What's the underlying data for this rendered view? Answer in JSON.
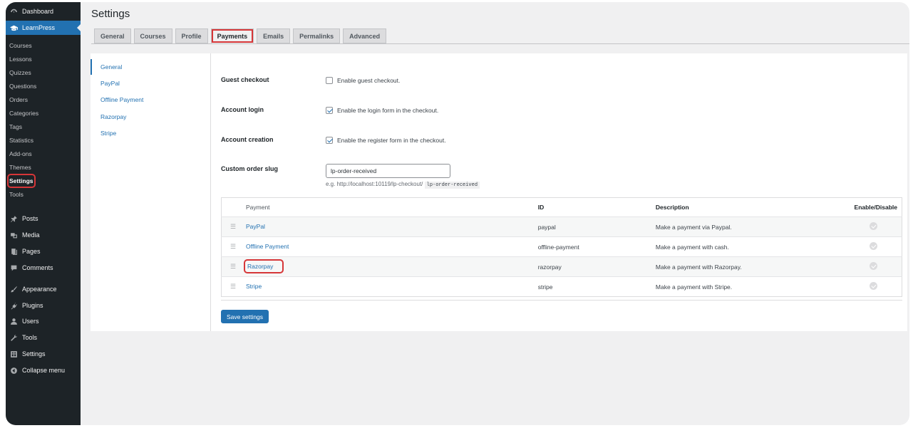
{
  "page_title": "Settings",
  "sidebar": {
    "top": [
      {
        "label": "Dashboard",
        "icon": "dashboard-icon"
      },
      {
        "label": "LearnPress",
        "icon": "graduation-cap-icon"
      }
    ],
    "learnpress_submenu": [
      "Courses",
      "Lessons",
      "Quizzes",
      "Questions",
      "Orders",
      "Categories",
      "Tags",
      "Statistics",
      "Add-ons",
      "Themes",
      "Settings",
      "Tools"
    ],
    "bottom": [
      {
        "label": "Posts",
        "icon": "pin-icon"
      },
      {
        "label": "Media",
        "icon": "media-icon"
      },
      {
        "label": "Pages",
        "icon": "pages-icon"
      },
      {
        "label": "Comments",
        "icon": "comments-icon"
      },
      {
        "label": "Appearance",
        "icon": "brush-icon"
      },
      {
        "label": "Plugins",
        "icon": "plugin-icon"
      },
      {
        "label": "Users",
        "icon": "users-icon"
      },
      {
        "label": "Tools",
        "icon": "wrench-icon"
      },
      {
        "label": "Settings",
        "icon": "settings-icon"
      },
      {
        "label": "Collapse menu",
        "icon": "collapse-icon"
      }
    ]
  },
  "tabs": [
    "General",
    "Courses",
    "Profile",
    "Payments",
    "Emails",
    "Permalinks",
    "Advanced"
  ],
  "subnav": [
    "General",
    "PayPal",
    "Offline Payment",
    "Razorpay",
    "Stripe"
  ],
  "form": {
    "guest_checkout": {
      "label": "Guest checkout",
      "text": "Enable guest checkout.",
      "checked": false
    },
    "account_login": {
      "label": "Account login",
      "text": "Enable the login form in the checkout.",
      "checked": true
    },
    "account_creation": {
      "label": "Account creation",
      "text": "Enable the register form in the checkout.",
      "checked": true
    },
    "order_slug": {
      "label": "Custom order slug",
      "value": "lp-order-received",
      "hint": "e.g. http://localhost:10119/lp-checkout/",
      "hint_code": "lp-order-received"
    }
  },
  "payments_table": {
    "headers": [
      "Payment",
      "ID",
      "Description",
      "Enable/Disable"
    ],
    "rows": [
      {
        "name": "PayPal",
        "id": "paypal",
        "description": "Make a payment via Paypal."
      },
      {
        "name": "Offline Payment",
        "id": "offline-payment",
        "description": "Make a payment with cash."
      },
      {
        "name": "Razorpay",
        "id": "razorpay",
        "description": "Make a payment with Razorpay."
      },
      {
        "name": "Stripe",
        "id": "stripe",
        "description": "Make a payment with Stripe."
      }
    ]
  },
  "save_label": "Save settings",
  "colors": {
    "accent": "#2271b1",
    "sidebar": "#1d2327",
    "highlight": "#d63638"
  }
}
